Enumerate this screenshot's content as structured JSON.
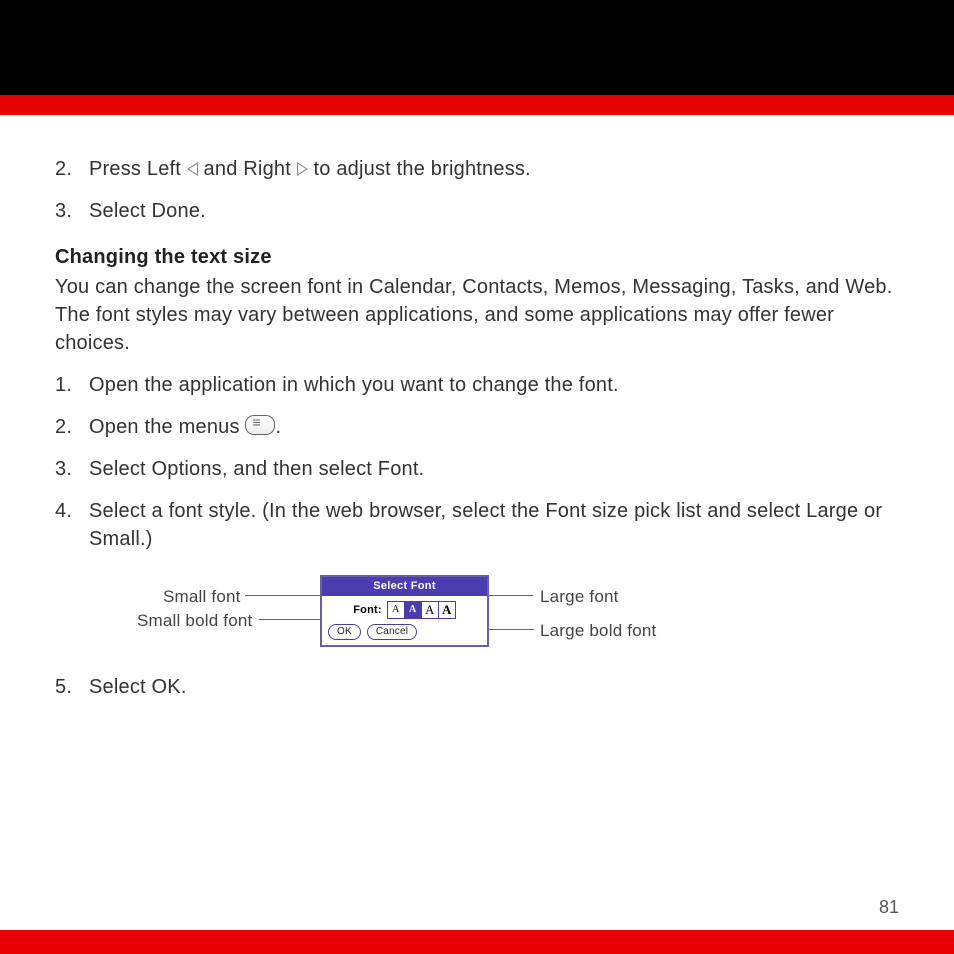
{
  "header": {
    "black": true,
    "red": true
  },
  "steps_a": [
    {
      "num": "2.",
      "before": "Press Left ",
      "mid": " and Right ",
      "after": " to adjust the brightness."
    },
    {
      "num": "3.",
      "text": "Select Done."
    }
  ],
  "section": {
    "heading": "Changing the text size",
    "intro": "You can change the screen font in Calendar, Contacts, Memos, Messaging, Tasks, and Web. The font styles may vary between applications, and some applications may offer fewer choices."
  },
  "steps_b": [
    {
      "num": "1.",
      "text": "Open the application in which you want to change the font."
    },
    {
      "num": "2.",
      "before": "Open the menus ",
      "after": "."
    },
    {
      "num": "3.",
      "text": "Select Options, and then select Font."
    },
    {
      "num": "4.",
      "text": "Select a font style. (In the web browser, select the Font size pick list and select Large or Small.)"
    }
  ],
  "figure": {
    "labels": {
      "small": "Small font",
      "smallbold": "Small bold font",
      "large": "Large font",
      "largebold": "Large bold font"
    },
    "dialog": {
      "title": "Select Font",
      "font_label": "Font:",
      "cells": [
        "A",
        "A",
        "A",
        "A"
      ],
      "ok": "OK",
      "cancel": "Cancel"
    }
  },
  "steps_c": [
    {
      "num": "5.",
      "text": "Select OK."
    }
  ],
  "page_number": "81"
}
